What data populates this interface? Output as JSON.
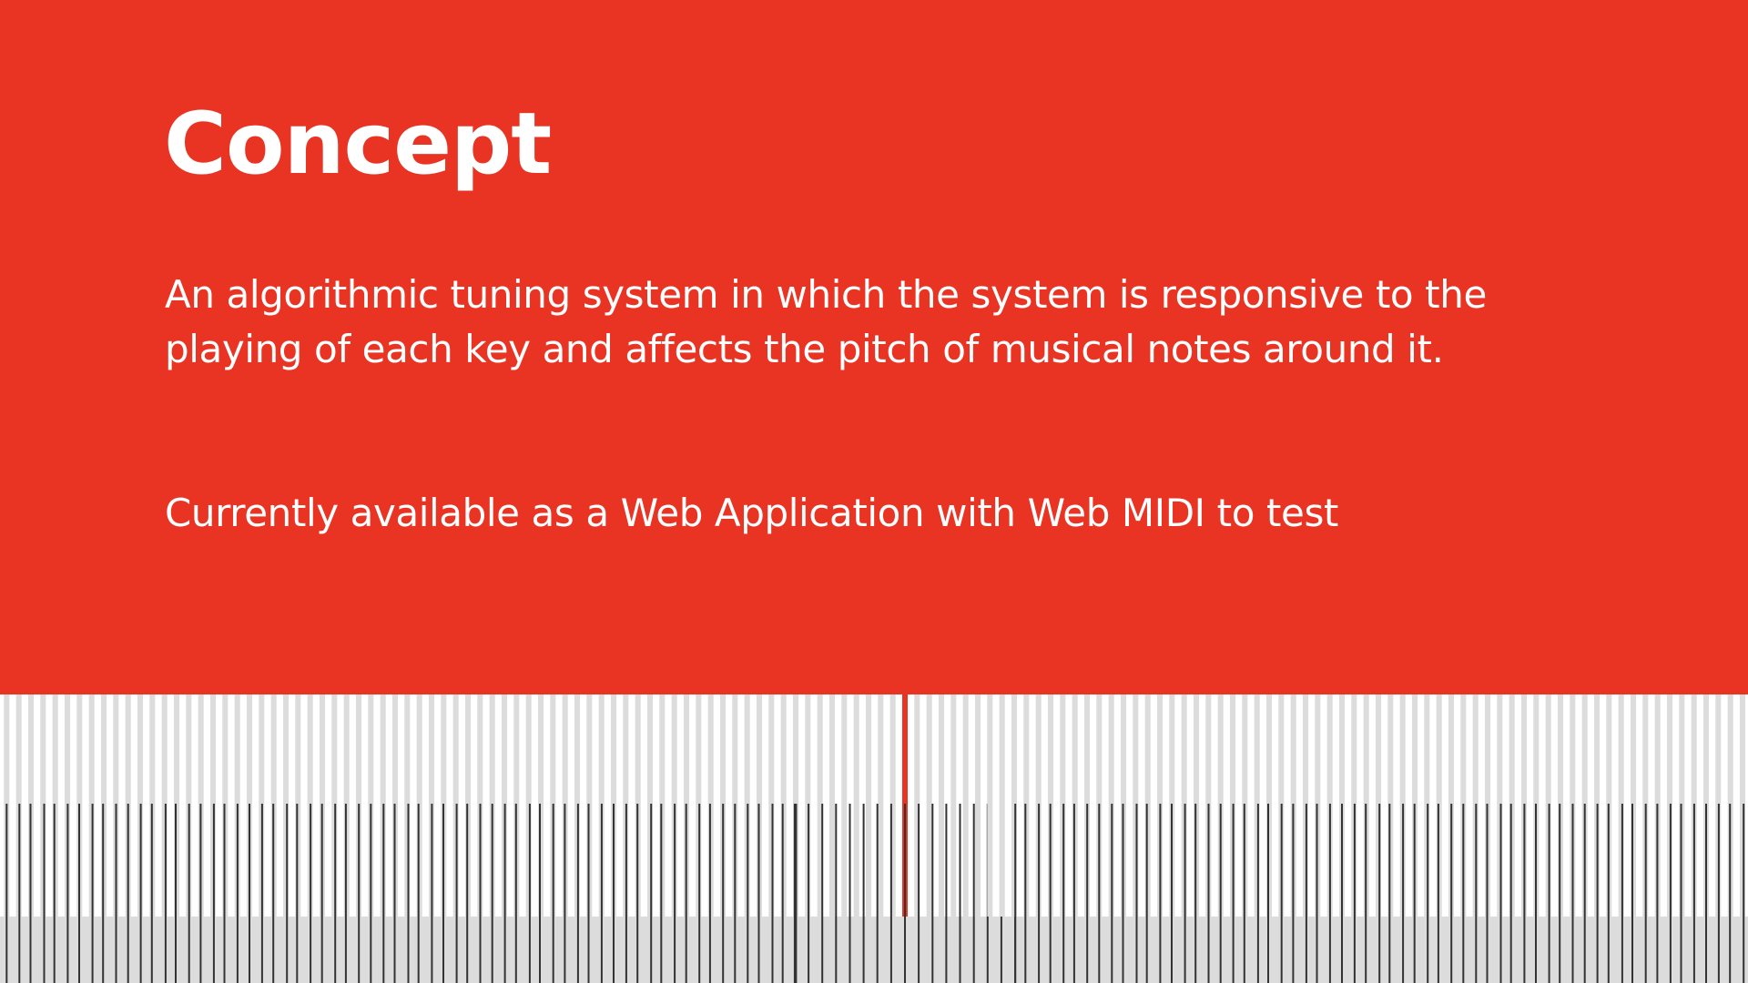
{
  "slide": {
    "title": "Concept",
    "paragraph_1": "An algorithmic tuning system in which the system is responsive to the playing of each key and affects the pitch of musical notes around it.",
    "paragraph_2": "Currently available as a Web Application with Web MIDI to test"
  },
  "colors": {
    "accent": "#e93323",
    "text": "#ffffff",
    "upper_tick": "#dcdcdc",
    "lower_tick": "#333333",
    "band": "#dcdcdc"
  },
  "keyboard": {
    "tick_count": 144,
    "highlighted_tick": 74
  }
}
